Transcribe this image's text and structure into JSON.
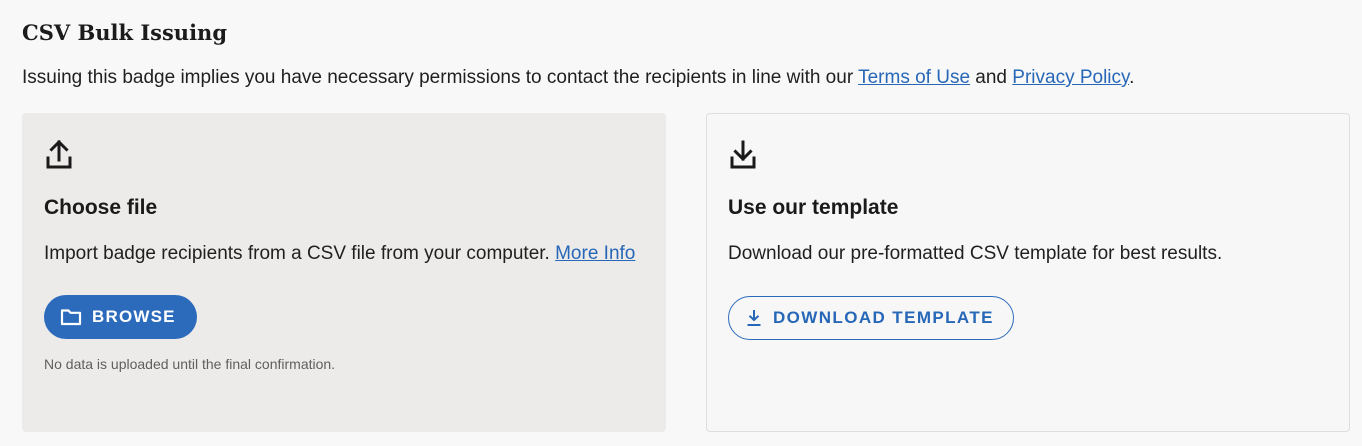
{
  "section": {
    "title": "CSV Bulk Issuing",
    "intro_text": "Issuing this badge implies you have necessary permissions to contact the recipients in line with our ",
    "terms_link": "Terms of Use",
    "and_text": " and ",
    "privacy_link": "Privacy Policy",
    "end_text": "."
  },
  "choose_file": {
    "icon": "upload-icon",
    "heading": "Choose file",
    "description": "Import badge recipients from a CSV file from your computer. ",
    "more_info_link": "More Info",
    "browse_button": {
      "icon": "folder-icon",
      "label": "BROWSE"
    },
    "note": "No data is uploaded until the final confirmation."
  },
  "template": {
    "icon": "download-icon",
    "heading": "Use our template",
    "description": "Download our pre-formatted CSV template for best results.",
    "download_button": {
      "icon": "download-small-icon",
      "label": "DOWNLOAD TEMPLATE"
    }
  },
  "colors": {
    "accent": "#2c6bbc",
    "link": "#2767b8",
    "left_card_bg": "#edebe9",
    "page_bg": "#f8f8f8"
  }
}
